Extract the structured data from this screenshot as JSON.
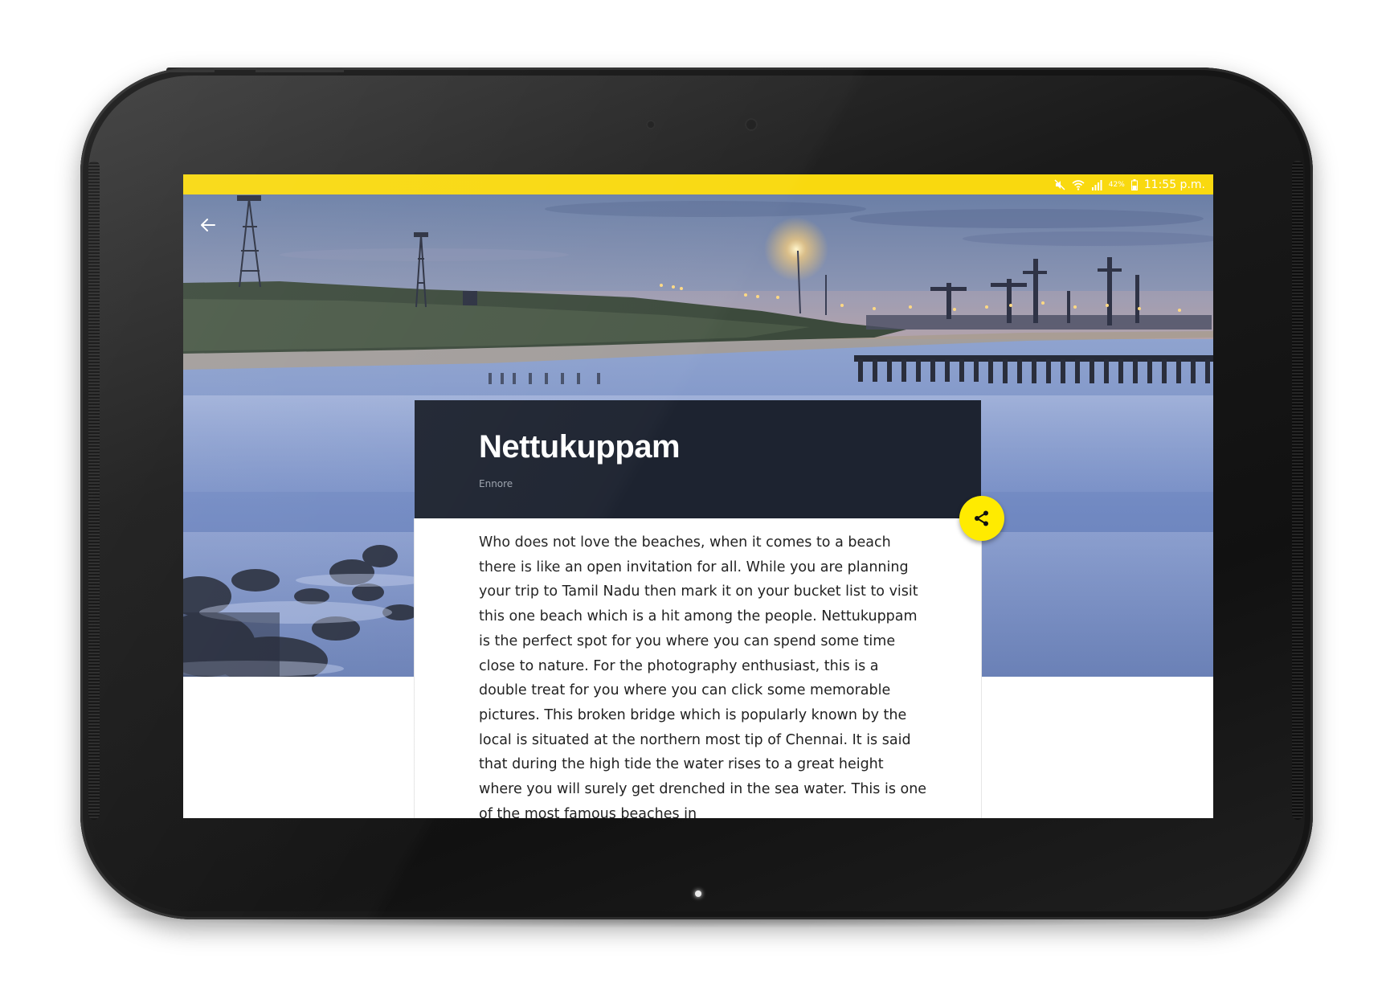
{
  "status_bar": {
    "battery_percent": "42%",
    "time": "11:55 p.m.",
    "background_color": "#f9d90f",
    "icons": [
      "mute-icon",
      "wifi-icon",
      "signal-icon",
      "battery-icon"
    ]
  },
  "toolbar": {
    "back_icon": "back-arrow-icon"
  },
  "place": {
    "title": "Nettukuppam",
    "location": "Ennore",
    "description": "Who does not love the beaches, when it comes to a beach there is like an open invitation for all. While you are planning your trip to Tamil Nadu then mark it on your bucket list to visit this one beach which is a hit among the people. Nettukuppam is the perfect spot for you where you can spend some time close to nature. For the photography enthusiast, this is a double treat for you where you can click some memorable pictures. This broken bridge which is popularly known by the local is situated at the northern most tip of Chennai. It is said that during the high tide the water rises to a great height where you will surely get drenched in the sea water. This is one of the most famous beaches in"
  },
  "share_button": {
    "icon": "share-icon",
    "color": "#ffeb00"
  },
  "colors": {
    "card_header": "#1d2330",
    "accent": "#ffeb00"
  }
}
